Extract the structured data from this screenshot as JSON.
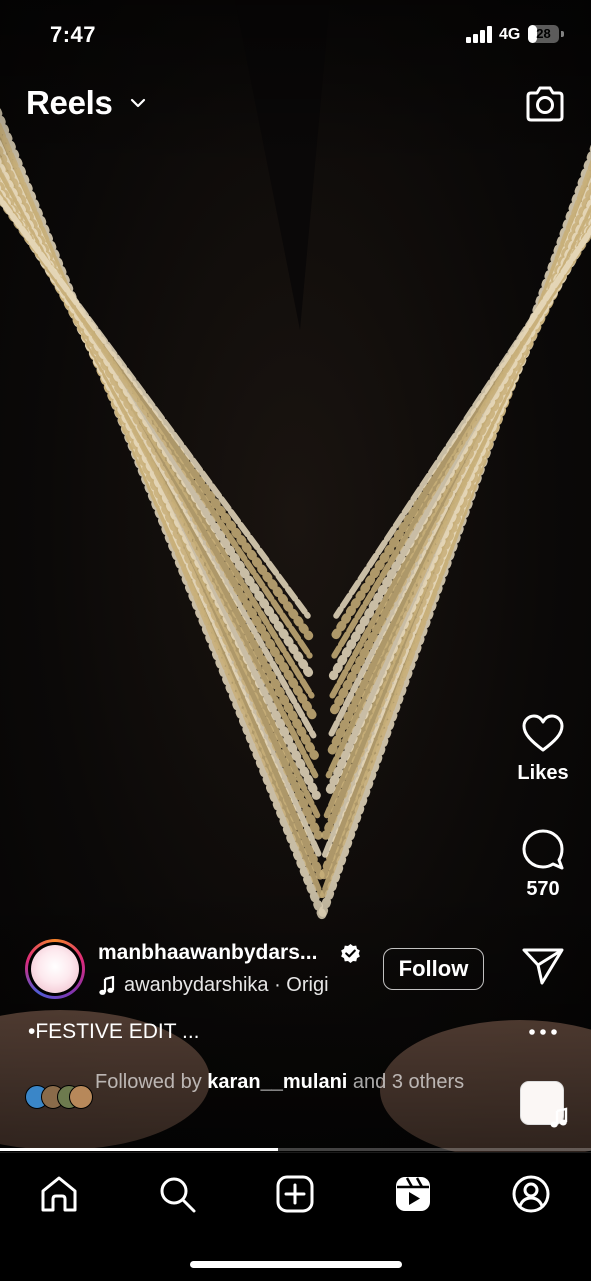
{
  "status_bar": {
    "time": "7:47",
    "network": "4G",
    "battery": "28",
    "battery_level": 0.28
  },
  "header": {
    "title": "Reels",
    "dropdown_icon": "chevron-down-icon",
    "camera_icon": "camera-icon"
  },
  "actions": {
    "like": {
      "icon": "heart-icon",
      "label": "Likes"
    },
    "comment": {
      "icon": "comment-icon",
      "count": "570"
    },
    "share": {
      "icon": "send-icon"
    },
    "more": {
      "icon": "more-horizontal-icon"
    },
    "audio": {
      "icon": "music-note-icon"
    }
  },
  "creator": {
    "username": "manbhaawanbydars...",
    "verified": true,
    "audio_text": "awanbydarshika · Origi",
    "follow_label": "Follow"
  },
  "caption": "•FESTIVE EDIT ...",
  "followed_by": {
    "prefix": "Followed by ",
    "user": "karan__mulani",
    "suffix": " and 3 others"
  },
  "playback": {
    "progress": 0.47
  },
  "bottom_nav": [
    {
      "name": "home",
      "icon": "home-icon"
    },
    {
      "name": "search",
      "icon": "search-icon"
    },
    {
      "name": "create",
      "icon": "plus-square-icon"
    },
    {
      "name": "reels",
      "icon": "reels-icon",
      "active": true
    },
    {
      "name": "profile",
      "icon": "profile-icon"
    }
  ],
  "colors": {
    "background": "#000000",
    "text": "#ffffff",
    "gold": "#c9b07a",
    "story_ring": "#dd2a7b",
    "verified": "#ffffff"
  }
}
